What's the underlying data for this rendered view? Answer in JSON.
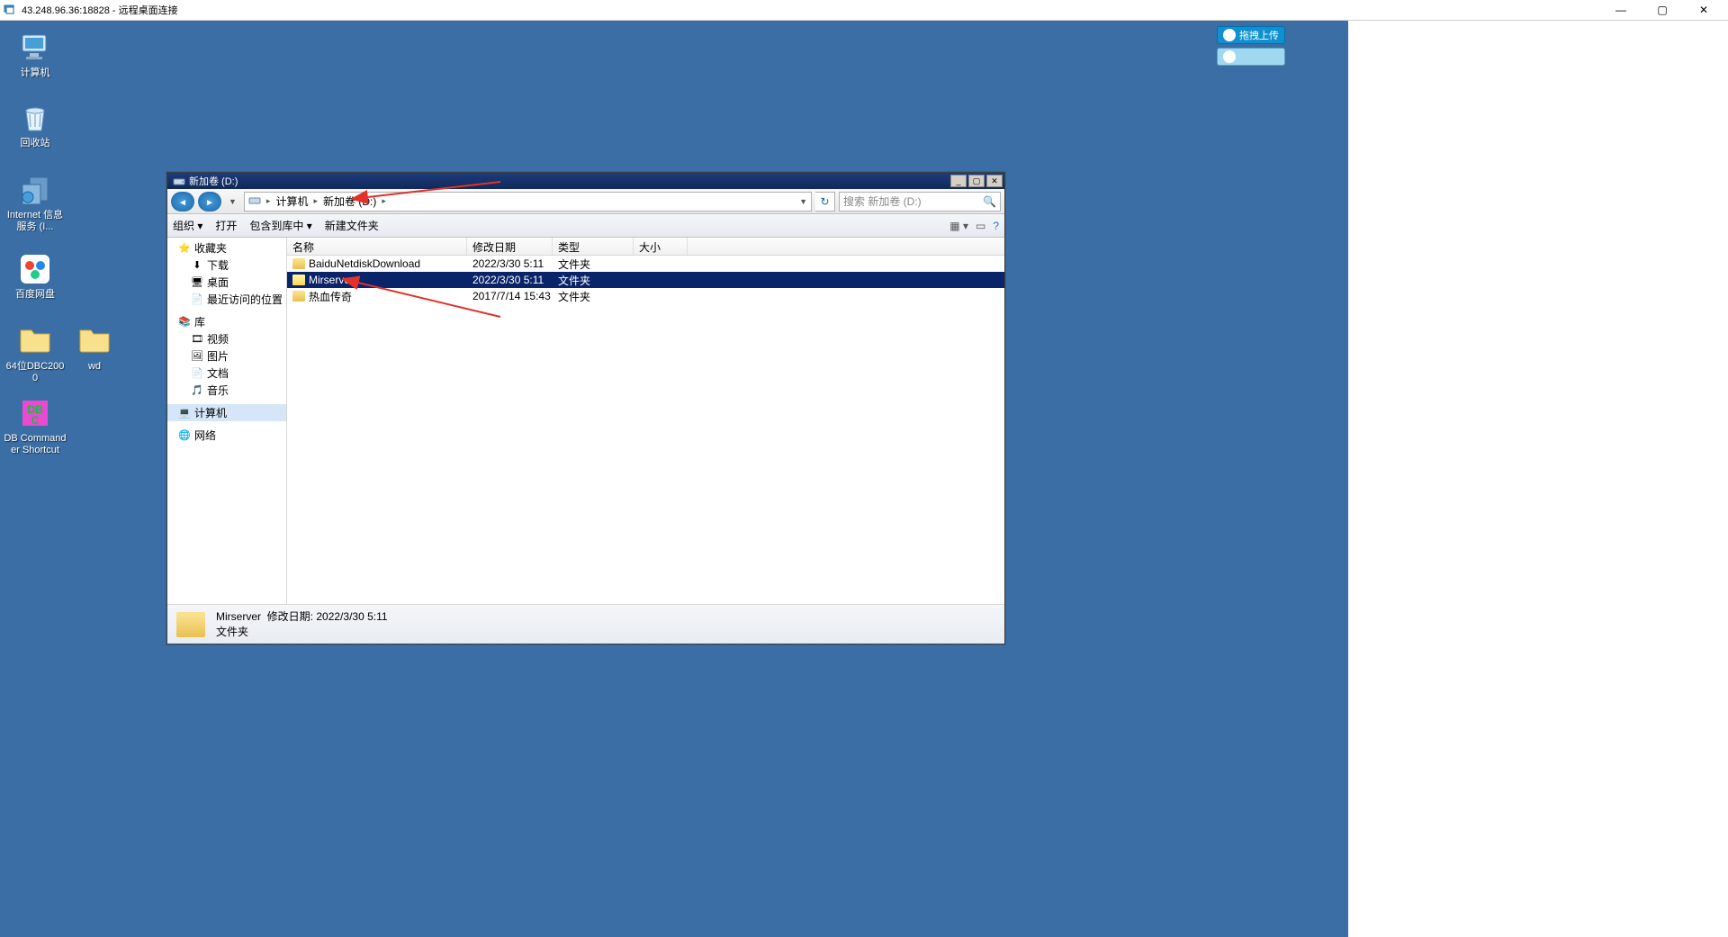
{
  "rdp": {
    "title": "43.248.96.36:18828 - 远程桌面连接",
    "min": "—",
    "max": "▢",
    "close": "✕"
  },
  "desktop_icons": [
    {
      "label": "计算机",
      "kind": "pc"
    },
    {
      "label": "回收站",
      "kind": "bin"
    },
    {
      "label": "Internet 信息服务 (I...",
      "kind": "globe"
    },
    {
      "label": "百度网盘",
      "kind": "cloud"
    },
    {
      "label": "64位DBC2000",
      "kind": "folder"
    },
    {
      "label": "wd",
      "kind": "folder"
    },
    {
      "label": "DB Commander Shortcut",
      "kind": "db"
    }
  ],
  "float_toolbar": {
    "label1": "拖拽上传",
    "label2": ""
  },
  "explorer": {
    "title": "新加卷 (D:)",
    "breadcrumb": [
      "计算机",
      "新加卷 (D:)"
    ],
    "search_placeholder": "搜索 新加卷 (D:)",
    "toolbar": {
      "organize": "组织 ▾",
      "open": "打开",
      "include": "包含到库中 ▾",
      "newfolder": "新建文件夹"
    },
    "tree": {
      "favorites": "收藏夹",
      "downloads": "下载",
      "desktop": "桌面",
      "recent": "最近访问的位置",
      "library": "库",
      "videos": "视频",
      "pictures": "图片",
      "documents": "文档",
      "music": "音乐",
      "computer": "计算机",
      "network": "网络"
    },
    "columns": {
      "name": "名称",
      "date": "修改日期",
      "type": "类型",
      "size": "大小"
    },
    "rows": [
      {
        "name": "BaiduNetdiskDownload",
        "date": "2022/3/30 5:11",
        "type": "文件夹",
        "size": ""
      },
      {
        "name": "Mirserver",
        "date": "2022/3/30 5:11",
        "type": "文件夹",
        "size": ""
      },
      {
        "name": "热血传奇",
        "date": "2017/7/14 15:43",
        "type": "文件夹",
        "size": ""
      }
    ],
    "selected_index": 1,
    "details": {
      "name": "Mirserver",
      "date_label": "修改日期:",
      "date": "2022/3/30 5:11",
      "type": "文件夹"
    }
  }
}
